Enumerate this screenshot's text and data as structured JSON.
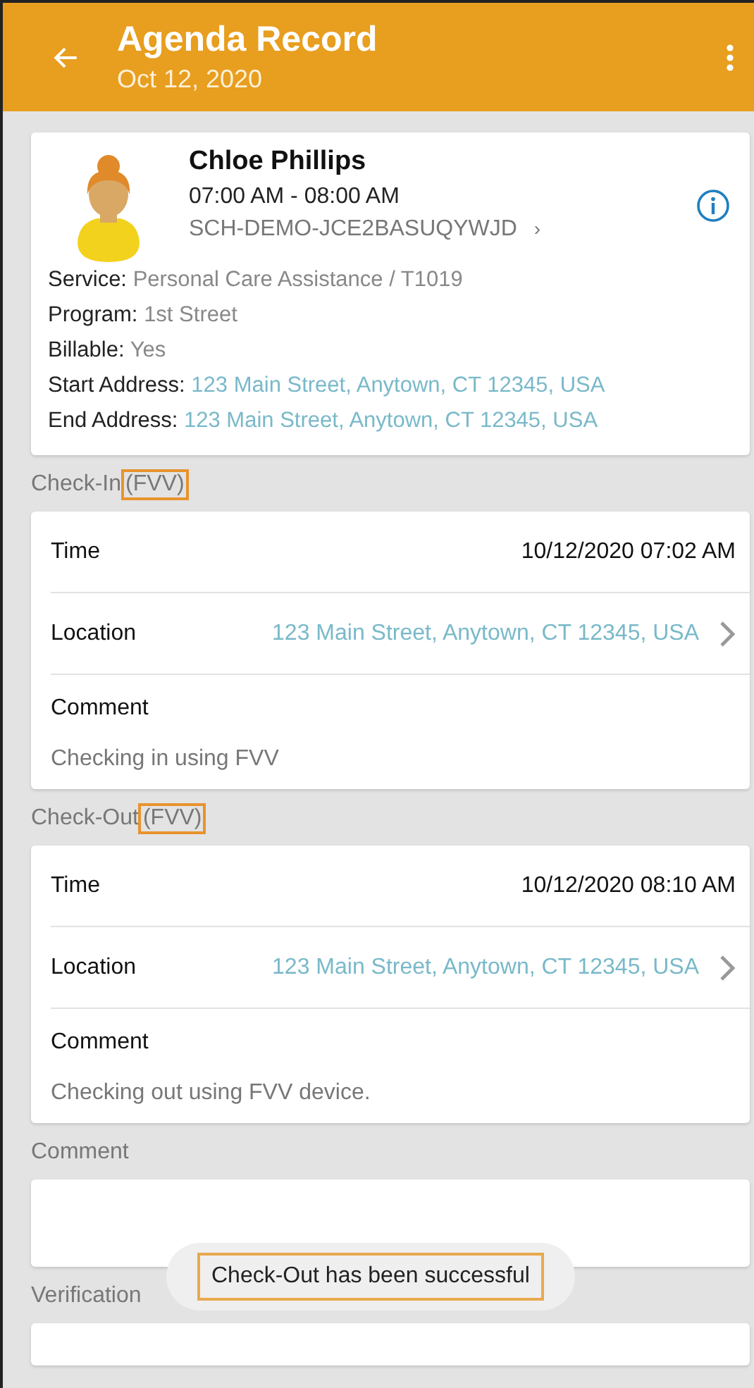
{
  "header": {
    "title": "Agenda Record",
    "subtitle": "Oct 12, 2020"
  },
  "client": {
    "name": "Chloe Phillips",
    "time": "07:00 AM - 08:00 AM",
    "code": "SCH-DEMO-JCE2BASUQYWJD",
    "code_mark": "›",
    "details": [
      {
        "label": "Service:",
        "value": "Personal Care Assistance / T1019",
        "kind": "plain"
      },
      {
        "label": "Program:",
        "value": "1st Street",
        "kind": "plain"
      },
      {
        "label": "Billable:",
        "value": "Yes",
        "kind": "plain"
      },
      {
        "label": "Start Address:",
        "value": "123 Main Street, Anytown, CT 12345, USA",
        "kind": "link"
      },
      {
        "label": "End Address:",
        "value": "123 Main Street, Anytown, CT 12345, USA",
        "kind": "link"
      }
    ]
  },
  "sections": [
    {
      "title": "Check-In",
      "tag": "(FVV)",
      "tag_highlighted": true,
      "time_label": "Time",
      "time": "10/12/2020 07:02 AM",
      "location_label": "Location",
      "location": "123 Main Street, Anytown, CT 12345, USA",
      "comment_label": "Comment",
      "comment": "Checking in using FVV"
    },
    {
      "title": "Check-Out",
      "tag": "(FVV)",
      "tag_highlighted": true,
      "time_label": "Time",
      "time": "10/12/2020 08:10 AM",
      "location_label": "Location",
      "location": "123 Main Street, Anytown, CT 12345, USA",
      "comment_label": "Comment",
      "comment": "Checking out using FVV device."
    }
  ],
  "comment_section": {
    "title": "Comment"
  },
  "toast": {
    "text": "Check-Out has been successful",
    "highlighted": true
  },
  "verification": {
    "title": "Verification"
  }
}
